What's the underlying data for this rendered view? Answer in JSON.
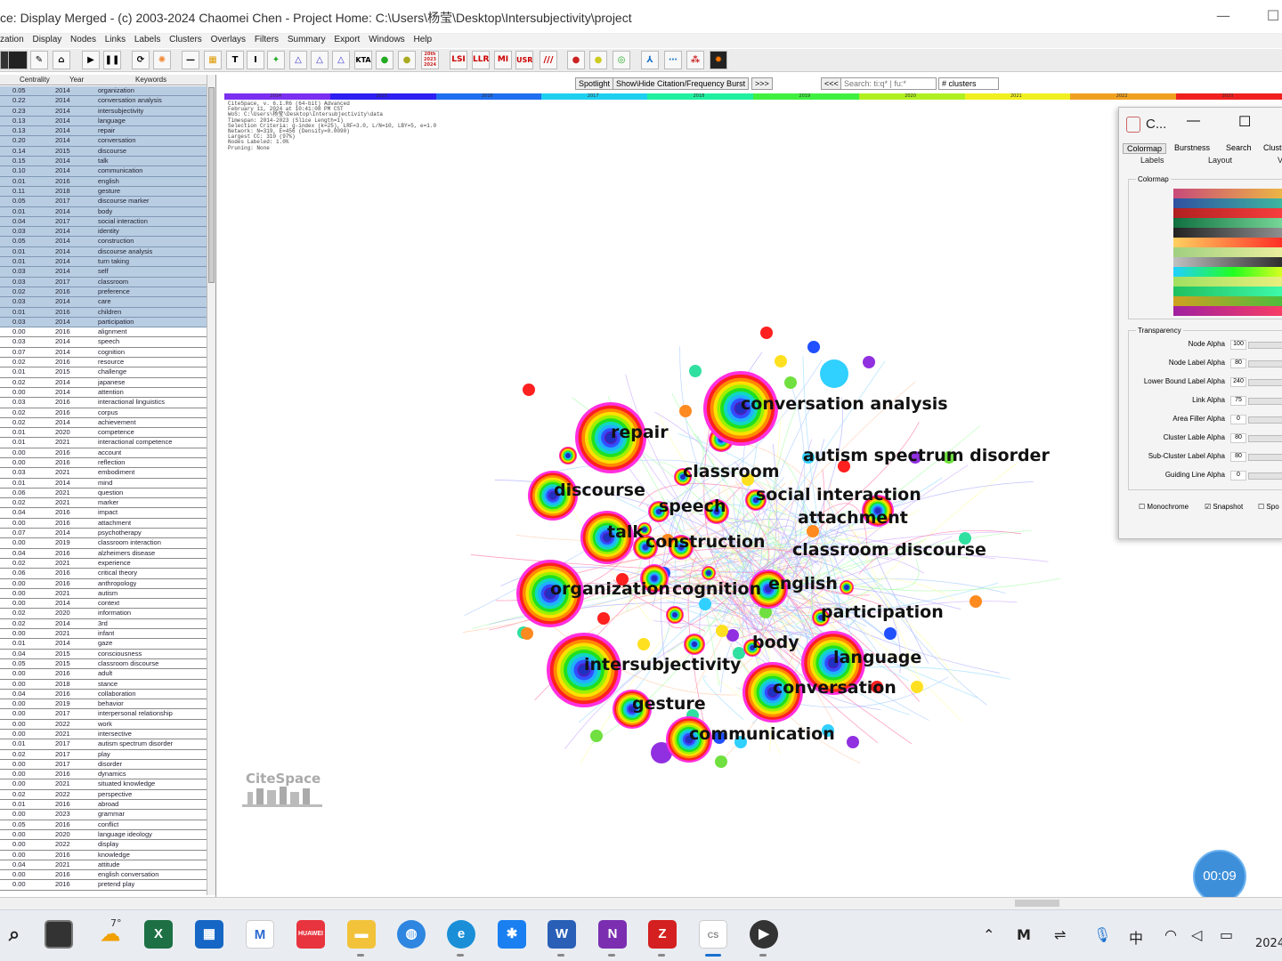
{
  "window": {
    "title": "ce: Display Merged - (c) 2003-2024 Chaomei Chen - Project Home: C:\\Users\\杨莹\\Desktop\\Intersubjectivity\\project",
    "minimize": "—",
    "maximize": "☐"
  },
  "menu": [
    "zation",
    "Display",
    "Nodes",
    "Links",
    "Labels",
    "Clusters",
    "Overlays",
    "Filters",
    "Summary",
    "Export",
    "Windows",
    "Help"
  ],
  "toolbar": {
    "lsi": "LSI",
    "llr": "LLR",
    "mi": "MI",
    "usr": "USR",
    "kta": "KTA",
    "slashes": "///",
    "year_badge": "20th 2023 2024"
  },
  "table": {
    "headers": {
      "centrality": "Centrality",
      "year": "Year",
      "keywords": "Keywords"
    },
    "rows": [
      [
        "0.05",
        "2014",
        "organization",
        1
      ],
      [
        "0.22",
        "2014",
        "conversation analysis",
        1
      ],
      [
        "0.23",
        "2014",
        "intersubjectivity",
        1
      ],
      [
        "0.13",
        "2014",
        "language",
        1
      ],
      [
        "0.13",
        "2014",
        "repair",
        1
      ],
      [
        "0.20",
        "2014",
        "conversation",
        1
      ],
      [
        "0.14",
        "2015",
        "discourse",
        1
      ],
      [
        "0.15",
        "2014",
        "talk",
        1
      ],
      [
        "0.10",
        "2014",
        "communication",
        1
      ],
      [
        "0.01",
        "2016",
        "english",
        1
      ],
      [
        "0.11",
        "2018",
        "gesture",
        1
      ],
      [
        "0.05",
        "2017",
        "discourse marker",
        1
      ],
      [
        "0.01",
        "2014",
        "body",
        1
      ],
      [
        "0.04",
        "2017",
        "social interaction",
        1
      ],
      [
        "0.03",
        "2014",
        "identity",
        1
      ],
      [
        "0.05",
        "2014",
        "construction",
        1
      ],
      [
        "0.01",
        "2014",
        "discourse analysis",
        1
      ],
      [
        "0.01",
        "2014",
        "turn taking",
        1
      ],
      [
        "0.03",
        "2014",
        "self",
        1
      ],
      [
        "0.03",
        "2017",
        "classroom",
        1
      ],
      [
        "0.02",
        "2016",
        "preference",
        1
      ],
      [
        "0.03",
        "2014",
        "care",
        1
      ],
      [
        "0.01",
        "2016",
        "children",
        1
      ],
      [
        "0.03",
        "2014",
        "participation",
        1
      ],
      [
        "0.00",
        "2016",
        "alignment",
        0
      ],
      [
        "0.03",
        "2014",
        "speech",
        0
      ],
      [
        "0.07",
        "2014",
        "cognition",
        0
      ],
      [
        "0.02",
        "2016",
        "resource",
        0
      ],
      [
        "0.01",
        "2015",
        "challenge",
        0
      ],
      [
        "0.02",
        "2014",
        "japanese",
        0
      ],
      [
        "0.00",
        "2014",
        "attention",
        0
      ],
      [
        "0.03",
        "2016",
        "interactional linguistics",
        0
      ],
      [
        "0.02",
        "2016",
        "corpus",
        0
      ],
      [
        "0.02",
        "2014",
        "achievement",
        0
      ],
      [
        "0.01",
        "2020",
        "competence",
        0
      ],
      [
        "0.01",
        "2021",
        "interactional competence",
        0
      ],
      [
        "0.00",
        "2016",
        "account",
        0
      ],
      [
        "0.00",
        "2016",
        "reflection",
        0
      ],
      [
        "0.03",
        "2021",
        "embodiment",
        0
      ],
      [
        "0.01",
        "2014",
        "mind",
        0
      ],
      [
        "0.06",
        "2021",
        "question",
        0
      ],
      [
        "0.02",
        "2021",
        "marker",
        0
      ],
      [
        "0.04",
        "2016",
        "impact",
        0
      ],
      [
        "0.00",
        "2016",
        "attachment",
        0
      ],
      [
        "0.07",
        "2014",
        "psychotherapy",
        0
      ],
      [
        "0.00",
        "2019",
        "classroom interaction",
        0
      ],
      [
        "0.04",
        "2016",
        "alzheimers disease",
        0
      ],
      [
        "0.02",
        "2021",
        "experience",
        0
      ],
      [
        "0.06",
        "2016",
        "critical theory",
        0
      ],
      [
        "0.00",
        "2016",
        "anthropology",
        0
      ],
      [
        "0.00",
        "2021",
        "autism",
        0
      ],
      [
        "0.00",
        "2014",
        "context",
        0
      ],
      [
        "0.02",
        "2020",
        "information",
        0
      ],
      [
        "0.02",
        "2014",
        "3rd",
        0
      ],
      [
        "0.00",
        "2021",
        "infant",
        0
      ],
      [
        "0.01",
        "2014",
        "gaze",
        0
      ],
      [
        "0.04",
        "2015",
        "consciousness",
        0
      ],
      [
        "0.05",
        "2015",
        "classroom discourse",
        0
      ],
      [
        "0.00",
        "2016",
        "adult",
        0
      ],
      [
        "0.00",
        "2018",
        "stance",
        0
      ],
      [
        "0.04",
        "2016",
        "collaboration",
        0
      ],
      [
        "0.00",
        "2019",
        "behavior",
        0
      ],
      [
        "0.00",
        "2017",
        "interpersonal relationship",
        0
      ],
      [
        "0.00",
        "2022",
        "work",
        0
      ],
      [
        "0.00",
        "2021",
        "intersective",
        0
      ],
      [
        "0.01",
        "2017",
        "autism spectrum disorder",
        0
      ],
      [
        "0.02",
        "2017",
        "play",
        0
      ],
      [
        "0.00",
        "2017",
        "disorder",
        0
      ],
      [
        "0.00",
        "2016",
        "dynamics",
        0
      ],
      [
        "0.00",
        "2021",
        "situated knowledge",
        0
      ],
      [
        "0.02",
        "2022",
        "perspective",
        0
      ],
      [
        "0.01",
        "2016",
        "abroad",
        0
      ],
      [
        "0.00",
        "2023",
        "grammar",
        0
      ],
      [
        "0.05",
        "2016",
        "conflict",
        0
      ],
      [
        "0.00",
        "2020",
        "language ideology",
        0
      ],
      [
        "0.00",
        "2022",
        "display",
        0
      ],
      [
        "0.00",
        "2016",
        "knowledge",
        0
      ],
      [
        "0.04",
        "2021",
        "attitude",
        0
      ],
      [
        "0.00",
        "2016",
        "english conversation",
        0
      ],
      [
        "0.00",
        "2016",
        "pretend play",
        0
      ]
    ]
  },
  "controls": {
    "spotlight": "Spotlight",
    "burst": "Show\\Hide Citation/Frequency Burst",
    "next": ">>>",
    "prev": "<<<",
    "search": "Search: ti:q* | fu:*",
    "clusters": "# clusters"
  },
  "timeline_years": [
    "2014",
    "2015",
    "2016",
    "2017",
    "2018",
    "2019",
    "2020",
    "2021",
    "2022",
    "2023"
  ],
  "timeline_colors": [
    "#7b2ff0",
    "#2f1ff0",
    "#1f6ff0",
    "#1fcff0",
    "#1ff0a0",
    "#40f040",
    "#b0f020",
    "#f0f020",
    "#f0a020",
    "#f02020"
  ],
  "info_lines": [
    "CiteSpace, v. 6.1.R6 (64-bit) Advanced",
    "February 11, 2024 at 10:41:08 PM CST",
    "WoS: C:\\Users\\杨莹\\Desktop\\Intersubjectivity\\data",
    "Timespan: 2014-2023 (Slice Length=1)",
    "Selection Criteria: g-index (k=25), LRF=3.0, L/N=10, LBY=5, e=1.0",
    "Network: N=319, E=456 (Density=0.0090)",
    "Largest CC: 310 (97%)",
    "Nodes Labeled: 1.0%",
    "Pruning: None"
  ],
  "graph": {
    "labels": [
      {
        "text": "conversation analysis"
      },
      {
        "text": "repair"
      },
      {
        "text": "autism spectrum disorder"
      },
      {
        "text": "classroom"
      },
      {
        "text": "discourse"
      },
      {
        "text": "social interaction"
      },
      {
        "text": "speech"
      },
      {
        "text": "attachment"
      },
      {
        "text": "talk"
      },
      {
        "text": "construction"
      },
      {
        "text": "classroom discourse"
      },
      {
        "text": "english"
      },
      {
        "text": "organization"
      },
      {
        "text": "cognition"
      },
      {
        "text": "participation"
      },
      {
        "text": "body"
      },
      {
        "text": "language"
      },
      {
        "text": "intersubjectivity"
      },
      {
        "text": "conversation"
      },
      {
        "text": "gesture"
      },
      {
        "text": "communication"
      }
    ],
    "logo_text": "CiteSpace"
  },
  "colormap_window": {
    "title": "C...",
    "tabs": [
      "Colormap",
      "Burstness",
      "Search",
      "Cluste"
    ],
    "subtabs": [
      "Labels",
      "Layout",
      "V"
    ],
    "colormap_group": "Colormap",
    "transparency_group": "Transparency",
    "sliders": [
      {
        "name": "Node Alpha",
        "value": "100"
      },
      {
        "name": "Node Label Alpha",
        "value": "80"
      },
      {
        "name": "Lower Bound Label Alpha",
        "value": "240"
      },
      {
        "name": "Link Alpha",
        "value": "75"
      },
      {
        "name": "Area Filler Alpha",
        "value": "0"
      },
      {
        "name": "Cluster Lable Alpha",
        "value": "80"
      },
      {
        "name": "Sub-Cluster Label Alpha",
        "value": "80"
      },
      {
        "name": "Guiding Line Alpha",
        "value": "0"
      }
    ],
    "checks": {
      "mono": "Monochrome",
      "snapshot": "Snapshot",
      "spot": "Spo"
    }
  },
  "timer": "00:09",
  "taskbar": {
    "weather": "7°",
    "tray_ime": "中",
    "clock": "2024"
  }
}
